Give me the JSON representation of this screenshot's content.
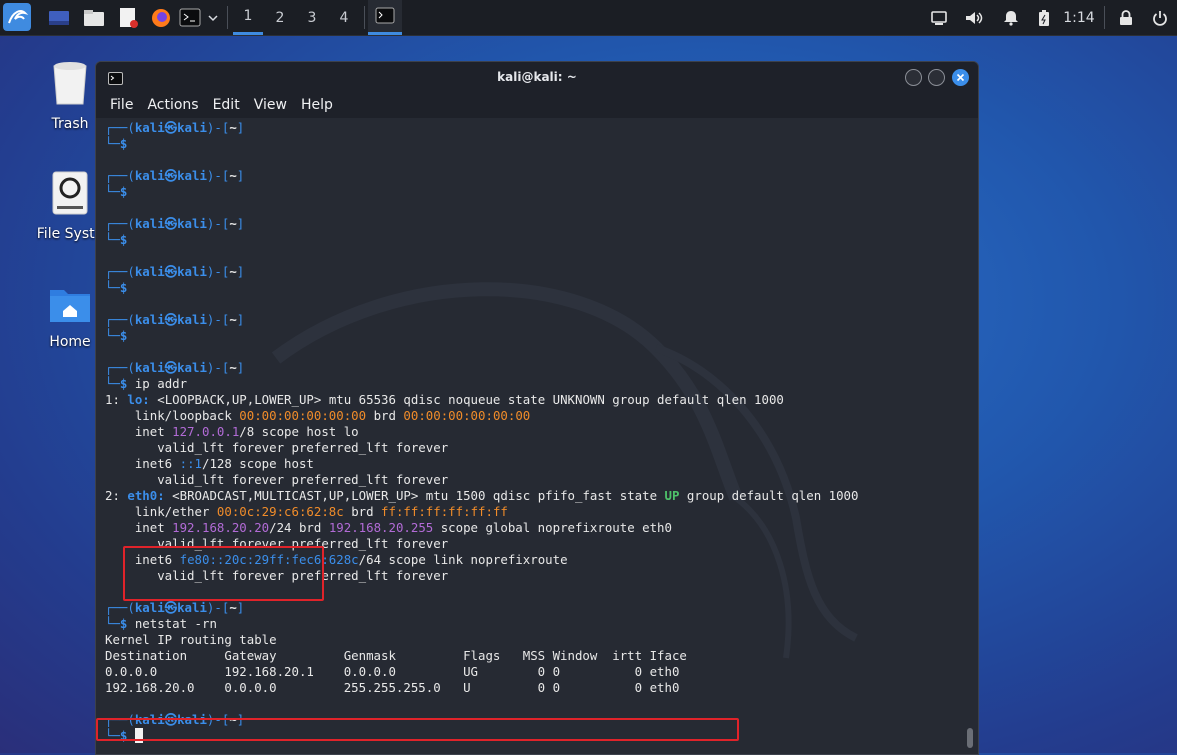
{
  "taskbar": {
    "workspaces": [
      "1",
      "2",
      "3",
      "4"
    ],
    "active_workspace": "1",
    "clock": "1:14"
  },
  "desktop": {
    "icons": [
      {
        "label": "Trash"
      },
      {
        "label": "File Syste"
      },
      {
        "label": "Home"
      }
    ]
  },
  "window": {
    "title": "kali@kali: ~",
    "menu": [
      "File",
      "Actions",
      "Edit",
      "View",
      "Help"
    ]
  },
  "terminal": {
    "prompt": {
      "user": "kali",
      "host": "kali",
      "dir": "~"
    },
    "commands": [
      "ip addr",
      "netstat -rn"
    ],
    "ip_addr": {
      "lo_line": [
        "1: ",
        "lo:",
        " <LOOPBACK,UP,LOWER_UP> mtu 65536 qdisc noqueue state UNKNOWN group default qlen 1000"
      ],
      "lo_link": [
        "    link/loopback ",
        "00:00:00:00:00:00",
        " brd ",
        "00:00:00:00:00:00"
      ],
      "lo_inet": [
        "    inet ",
        "127.0.0.1",
        "/8 scope host lo"
      ],
      "lo_valid1": "       valid_lft forever preferred_lft forever",
      "lo_inet6": [
        "    inet6 ",
        "::1",
        "/128 scope host"
      ],
      "lo_valid2": "       valid_lft forever preferred_lft forever",
      "eth_line": [
        "2: ",
        "eth0:",
        " <BROADCAST,MULTICAST,UP,LOWER_UP> mtu 1500 qdisc pfifo_fast state ",
        "UP",
        " group default qlen 1000"
      ],
      "eth_link": [
        "    link/ether ",
        "00:0c:29:c6:62:8c",
        " brd ",
        "ff:ff:ff:ff:ff:ff"
      ],
      "eth_inet": [
        "    inet ",
        "192.168.20.20",
        "/24 brd ",
        "192.168.20.255",
        " scope global noprefixroute eth0"
      ],
      "eth_valid1": "       valid_lft forever preferred_lft forever",
      "eth_inet6": [
        "    inet6 ",
        "fe80::20c:29ff:fec6:628c",
        "/64 scope link noprefixroute"
      ],
      "eth_valid2": "       valid_lft forever preferred_lft forever"
    },
    "netstat": {
      "title": "Kernel IP routing table",
      "header": "Destination     Gateway         Genmask         Flags   MSS Window  irtt Iface",
      "rows": [
        "0.0.0.0         192.168.20.1    0.0.0.0         UG        0 0          0 eth0",
        "192.168.20.0    0.0.0.0         255.255.255.0   U         0 0          0 eth0"
      ]
    }
  },
  "colors": {
    "prompt_blue": "#3b8eea",
    "mac_orange": "#f08c2a",
    "ip_purple": "#b26bd6",
    "state_green": "#4ec26a",
    "highlight_red": "#e0232a"
  }
}
